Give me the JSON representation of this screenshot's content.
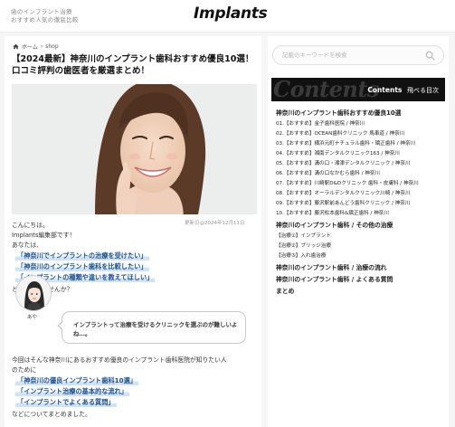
{
  "header": {
    "tagline_line1": "歯のインプラント治療",
    "tagline_line2": "おすすめ人気の徹底比較",
    "logo": "Implants"
  },
  "breadcrumb": {
    "home": "ホーム",
    "separator": "›",
    "current": "shop"
  },
  "article": {
    "title": "【2024最新】神奈川のインプラント歯科おすすめ優良10選！口コミ評判の歯医者を厳選まとめ！",
    "date": "更新日@2024年12月11日",
    "intro": [
      "こんにちは。",
      "Implants編集部です！",
      "あなたは、"
    ],
    "highlights_1": [
      "「神奈川でインプラントの治療を受けたい」",
      "「神奈川のインプラント歯科を比較したい」",
      "「インプラントの種類や違いを教えてほしい」"
    ],
    "after_highlights_1": "と思っていませんか？",
    "speech": {
      "avatar_name": "あや",
      "text": "インプラントって治療を受けるクリニックを選ぶのが難しいよね…。"
    },
    "para_2_line1": "今回はそんな神奈川にあるおすすめ優良のインプラント歯科医院が知りたい人",
    "para_2_line2": "のために",
    "highlights_2": [
      "「神奈川の優良インプラント歯科10選」",
      "「インプラント治療の基本的な流れ」",
      "「インプラントでよくある質問」"
    ],
    "closing": "などについてまとめました。"
  },
  "sidebar": {
    "search_placeholder": "記載のキーワードを検索",
    "contents_watermark": "Contents",
    "contents_title": "Contents",
    "contents_subtitle": "飛べる目次",
    "toc": [
      "神奈川のインプラント歯科おすすめ優良10選",
      "01.【おすすめ】金子歯科医院 / 神奈川",
      "02.【おすすめ】OCEAN歯科クリニック 馬車道 / 神奈川",
      "03.【おすすめ】横浜元町ナチュラル歯科・矯正歯科 / 神奈川",
      "04.【おすすめ】湘南デンタルクリニック163 / 神奈川",
      "05.【おすすめ】溝の口・湘津デンタルクリニック / 神奈川",
      "06.【おすすめ】溝の口なかむら歯科 / 神奈川",
      "07.【おすすめ】川崎駅D&Dクリニック 歯科・皮膚科 / 神奈川",
      "08.【おすすめ】オーラルデンタルクリニック川崎 / 神奈川",
      "09.【おすすめ】藤沢駅前あんどう歯科クリニック / 神奈川",
      "10.【おすすめ】藤沢松本歯科&矯正歯科 / 神奈川",
      "神奈川のインプラント歯科 / その他の治療",
      "【治療①】インプラント",
      "【治療②】ブリッジ治療",
      "【治療③】入れ歯治療",
      "神奈川のインプラント歯科 / 治療の流れ",
      "神奈川のインプラント歯科 / よくある質問",
      "まとめ"
    ]
  },
  "colors": {
    "highlight_text": "#1a4e8f",
    "highlight_marker": "#cfe3f5",
    "contents_bg": "#111111"
  }
}
